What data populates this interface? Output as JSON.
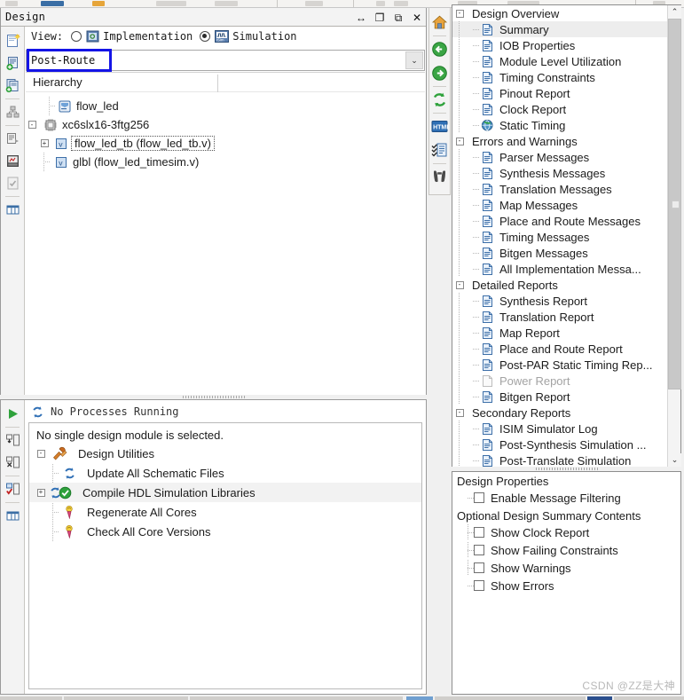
{
  "window": {
    "panel_title": "Design",
    "title_buttons": [
      {
        "name": "resize-button",
        "glyph": "↔"
      },
      {
        "name": "maximize-button",
        "glyph": "❐"
      },
      {
        "name": "restore-button",
        "glyph": "⧉"
      },
      {
        "name": "close-button",
        "glyph": "✕"
      }
    ]
  },
  "view": {
    "label": "View:",
    "implementation_label": "Implementation",
    "simulation_label": "Simulation",
    "implementation_selected": false,
    "simulation_selected": true
  },
  "combo": {
    "value": "Post-Route",
    "arrow": "⌄",
    "annotated": true,
    "annotation_color": "#1414e6"
  },
  "hierarchy": {
    "header": "Hierarchy",
    "nodes": [
      {
        "label": "flow_led",
        "icon": "project-icon",
        "depth": 1,
        "expander": "",
        "selected": false
      },
      {
        "label": "xc6slx16-3ftg256",
        "icon": "device-icon",
        "depth": 0,
        "expander": "-",
        "selected": false
      },
      {
        "label": "flow_led_tb (flow_led_tb.v)",
        "icon": "verilog-icon",
        "depth": 1,
        "expander": "+",
        "selected": true
      },
      {
        "label": "glbl (flow_led_timesim.v)",
        "icon": "verilog-icon",
        "depth": 1,
        "expander": "",
        "selected": false
      }
    ]
  },
  "design_toolbar": [
    {
      "name": "new-source-icon"
    },
    {
      "name": "add-source-icon"
    },
    {
      "name": "add-copy-of-source-icon"
    },
    {
      "name": "design-utilities-icon"
    },
    {
      "name": "manual-compile-order-icon"
    },
    {
      "name": "design-goals-icon"
    },
    {
      "name": "design-summary-icon"
    },
    {
      "name": "view-panels-icon"
    }
  ],
  "processes": {
    "status": "No Processes Running",
    "message": "No single design module is selected.",
    "toolbar": [
      {
        "name": "run-process-icon"
      },
      {
        "name": "rerun-process-icon"
      },
      {
        "name": "rerun-all-icon"
      },
      {
        "name": "stop-process-icon"
      },
      {
        "name": "process-properties-icon"
      }
    ],
    "tree": [
      {
        "label": "Design Utilities",
        "icon": "utilities-icon",
        "expander": "-",
        "depth": 0,
        "selected": false,
        "status": ""
      },
      {
        "label": "Update All Schematic Files",
        "icon": "process-icon",
        "expander": "",
        "depth": 1,
        "selected": false,
        "status": ""
      },
      {
        "label": "Compile HDL Simulation Libraries",
        "icon": "process-icon",
        "expander": "+",
        "depth": 1,
        "selected": true,
        "status": "done"
      },
      {
        "label": "Regenerate All Cores",
        "icon": "core-icon",
        "expander": "",
        "depth": 1,
        "selected": false,
        "status": ""
      },
      {
        "label": "Check All Core Versions",
        "icon": "core-icon",
        "expander": "",
        "depth": 1,
        "selected": false,
        "status": ""
      }
    ]
  },
  "summary_toolbar": [
    {
      "name": "home-icon"
    },
    {
      "name": "back-arrow-icon"
    },
    {
      "name": "forward-arrow-icon"
    },
    {
      "name": "refresh-icon"
    },
    {
      "name": "html-report-icon"
    },
    {
      "name": "detailed-reports-icon"
    },
    {
      "name": "find-icon"
    }
  ],
  "design_summary": {
    "nodes": [
      {
        "label": "Design Overview",
        "kind": "group",
        "expander": "-",
        "selected": false,
        "dim": false
      },
      {
        "label": "Summary",
        "kind": "doc",
        "expander": "",
        "selected": true,
        "dim": false
      },
      {
        "label": "IOB Properties",
        "kind": "doc",
        "expander": "",
        "selected": false,
        "dim": false
      },
      {
        "label": "Module Level Utilization",
        "kind": "doc",
        "expander": "",
        "selected": false,
        "dim": false
      },
      {
        "label": "Timing Constraints",
        "kind": "doc",
        "expander": "",
        "selected": false,
        "dim": false
      },
      {
        "label": "Pinout Report",
        "kind": "doc",
        "expander": "",
        "selected": false,
        "dim": false
      },
      {
        "label": "Clock Report",
        "kind": "doc",
        "expander": "",
        "selected": false,
        "dim": false
      },
      {
        "label": "Static Timing",
        "kind": "globe",
        "expander": "",
        "selected": false,
        "dim": false
      },
      {
        "label": "Errors and Warnings",
        "kind": "group",
        "expander": "-",
        "selected": false,
        "dim": false
      },
      {
        "label": "Parser Messages",
        "kind": "doc",
        "expander": "",
        "selected": false,
        "dim": false
      },
      {
        "label": "Synthesis Messages",
        "kind": "doc",
        "expander": "",
        "selected": false,
        "dim": false
      },
      {
        "label": "Translation Messages",
        "kind": "doc",
        "expander": "",
        "selected": false,
        "dim": false
      },
      {
        "label": "Map Messages",
        "kind": "doc",
        "expander": "",
        "selected": false,
        "dim": false
      },
      {
        "label": "Place and Route Messages",
        "kind": "doc",
        "expander": "",
        "selected": false,
        "dim": false
      },
      {
        "label": "Timing Messages",
        "kind": "doc",
        "expander": "",
        "selected": false,
        "dim": false
      },
      {
        "label": "Bitgen Messages",
        "kind": "doc",
        "expander": "",
        "selected": false,
        "dim": false
      },
      {
        "label": "All Implementation Messa...",
        "kind": "doc",
        "expander": "",
        "selected": false,
        "dim": false
      },
      {
        "label": "Detailed Reports",
        "kind": "group",
        "expander": "-",
        "selected": false,
        "dim": false
      },
      {
        "label": "Synthesis Report",
        "kind": "doc",
        "expander": "",
        "selected": false,
        "dim": false
      },
      {
        "label": "Translation Report",
        "kind": "doc",
        "expander": "",
        "selected": false,
        "dim": false
      },
      {
        "label": "Map Report",
        "kind": "doc",
        "expander": "",
        "selected": false,
        "dim": false
      },
      {
        "label": "Place and Route Report",
        "kind": "doc",
        "expander": "",
        "selected": false,
        "dim": false
      },
      {
        "label": "Post-PAR Static Timing Rep...",
        "kind": "doc",
        "expander": "",
        "selected": false,
        "dim": false
      },
      {
        "label": "Power Report",
        "kind": "doc-dim",
        "expander": "",
        "selected": false,
        "dim": true
      },
      {
        "label": "Bitgen Report",
        "kind": "doc",
        "expander": "",
        "selected": false,
        "dim": false
      },
      {
        "label": "Secondary Reports",
        "kind": "group",
        "expander": "-",
        "selected": false,
        "dim": false
      },
      {
        "label": "ISIM Simulator Log",
        "kind": "doc",
        "expander": "",
        "selected": false,
        "dim": false
      },
      {
        "label": "Post-Synthesis Simulation ...",
        "kind": "doc",
        "expander": "",
        "selected": false,
        "dim": false
      },
      {
        "label": "Post-Translate Simulation",
        "kind": "doc",
        "expander": "",
        "selected": false,
        "dim": false
      }
    ],
    "scroll_up_glyph": "⌃",
    "scroll_down_glyph": "⌄"
  },
  "design_properties": {
    "title": "Design Properties",
    "enable_message_filtering": {
      "label": "Enable Message Filtering",
      "checked": false
    },
    "optional_title": "Optional Design Summary Contents",
    "options": [
      {
        "label": "Show Clock Report",
        "checked": false
      },
      {
        "label": "Show Failing Constraints",
        "checked": false
      },
      {
        "label": "Show Warnings",
        "checked": false
      },
      {
        "label": "Show Errors",
        "checked": false
      }
    ]
  },
  "watermark": "CSDN @ZZ是大神"
}
